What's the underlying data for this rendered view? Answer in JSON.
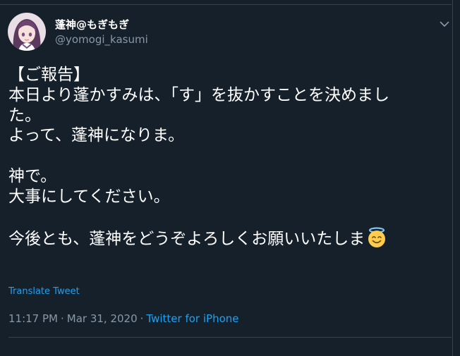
{
  "colors": {
    "background": "#15202b",
    "text": "#ffffff",
    "secondary": "#8899a6",
    "accent": "#1da1f2",
    "divider": "#38444d"
  },
  "author": {
    "display_name": "蓬神@もぎもぎ",
    "handle": "@yomogi_kasumi",
    "avatar_icon": "anime-girl-avatar"
  },
  "menu_icon": "chevron-down-icon",
  "tweet": {
    "lines": [
      "【ご報告】",
      "本日より蓬かすみは、「す」を抜かすことを決めまし",
      "た。",
      "よって、蓬神になりま。",
      "",
      "神で。",
      "大事にしてください。",
      "",
      "今後とも、蓬神をどうぞよろしくお願いいたしま"
    ],
    "emoji": "smiling-face-with-halo"
  },
  "translate_label": "Translate Tweet",
  "meta": {
    "time": "11:17 PM",
    "separator": "·",
    "date": "Mar 31, 2020",
    "separator2": "·",
    "source": "Twitter for iPhone"
  }
}
